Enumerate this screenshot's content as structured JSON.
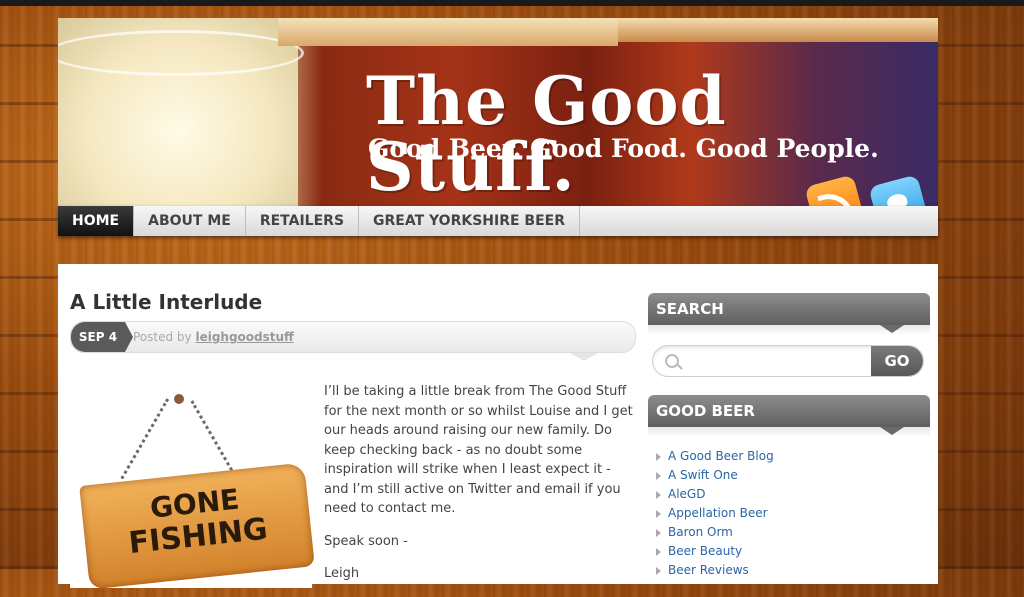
{
  "site": {
    "title": "The Good Stuff.",
    "tagline": "Good Beer. Good Food. Good People.",
    "icons": [
      "feed-icon",
      "twitter-icon"
    ]
  },
  "nav": {
    "items": [
      {
        "label": "HOME",
        "active": true
      },
      {
        "label": "ABOUT ME",
        "active": false
      },
      {
        "label": "RETAILERS",
        "active": false
      },
      {
        "label": "GREAT YORKSHIRE BEER",
        "active": false
      }
    ]
  },
  "post": {
    "title": "A Little Interlude",
    "date": "SEP 4",
    "posted_by": "Posted by",
    "author": "leighgoodstuff",
    "image_text": [
      "GONE",
      "FISHING"
    ],
    "paragraphs": [
      "I’ll be taking a little break from The Good Stuff for the next month or so whilst Louise and I get our heads around raising our new family. Do keep checking back - as no doubt some inspiration will strike when I least expect it - and I’m still active on Twitter and email if you need to contact me.",
      "Speak soon -",
      "Leigh"
    ]
  },
  "sidebar": {
    "search": {
      "heading": "SEARCH",
      "placeholder": "",
      "button": "GO"
    },
    "good_beer": {
      "heading": "GOOD BEER",
      "links": [
        "A Good Beer Blog",
        "A Swift One",
        "AleGD",
        "Appellation Beer",
        "Baron Orm",
        "Beer Beauty",
        "Beer Reviews"
      ]
    }
  },
  "colors": {
    "accent_link": "#2b66a6",
    "nav_active": "#1a1a1a",
    "widget_head": "#6e6e6e"
  }
}
